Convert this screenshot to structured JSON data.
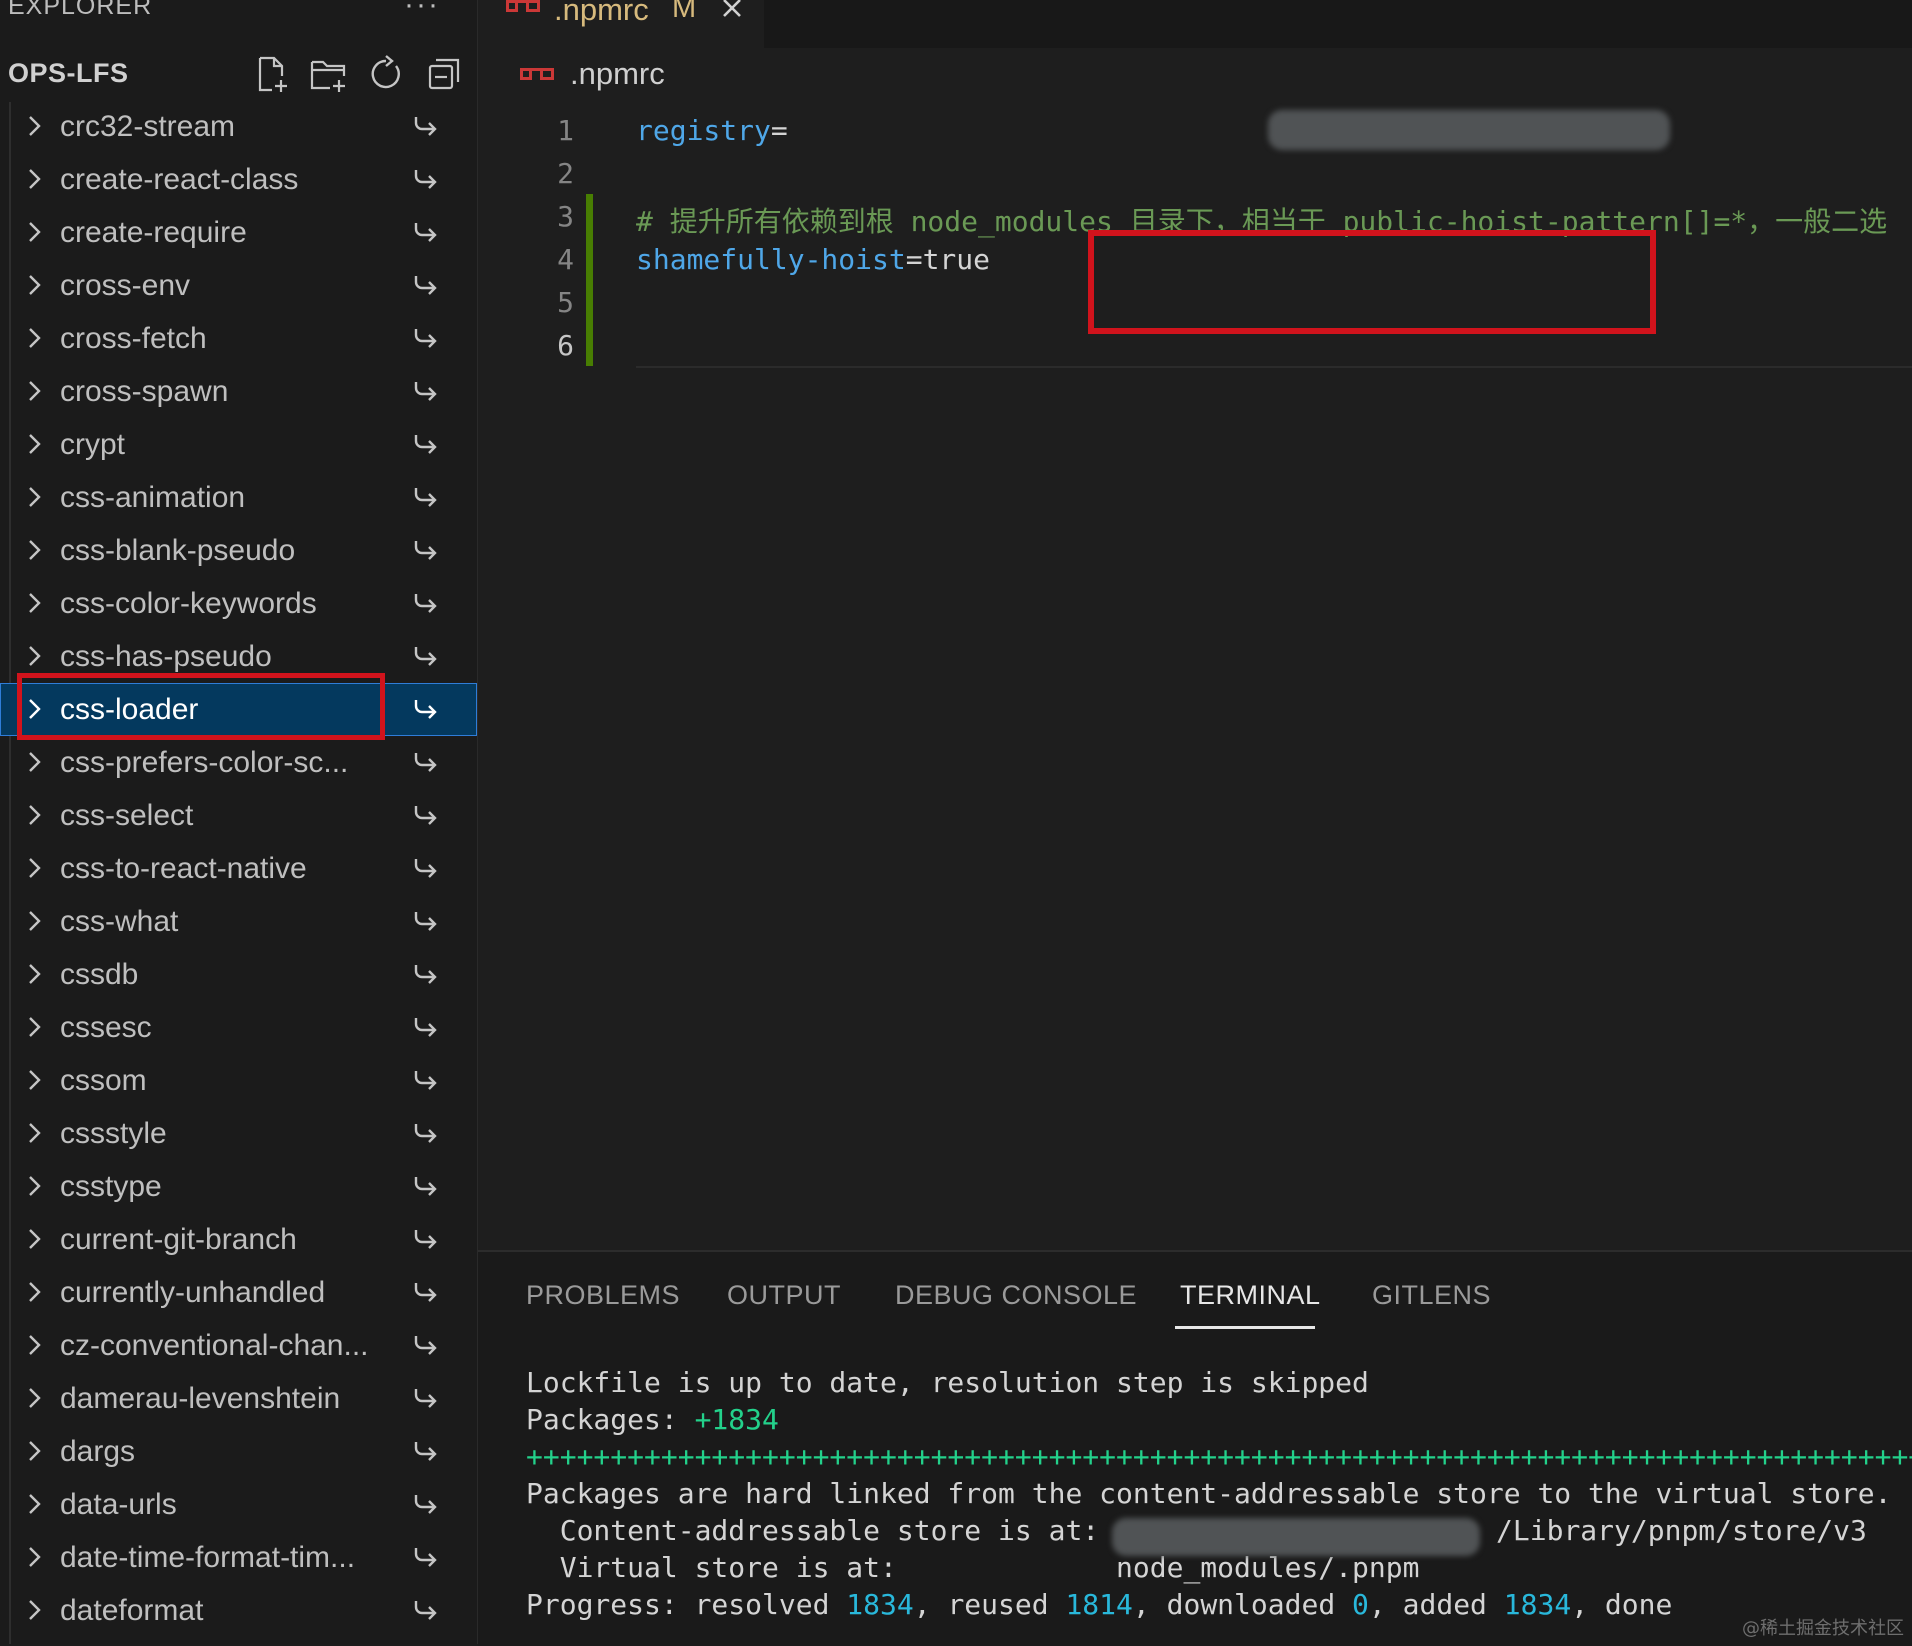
{
  "explorer": {
    "title": "EXPLORER",
    "more": "···",
    "project": "OPS-LFS",
    "actions": [
      "new-file-icon",
      "new-folder-icon",
      "refresh-icon",
      "collapse-all-icon"
    ]
  },
  "tree": {
    "items": [
      "crc32-stream",
      "create-react-class",
      "create-require",
      "cross-env",
      "cross-fetch",
      "cross-spawn",
      "crypt",
      "css-animation",
      "css-blank-pseudo",
      "css-color-keywords",
      "css-has-pseudo",
      "css-loader",
      "css-prefers-color-sc...",
      "css-select",
      "css-to-react-native",
      "css-what",
      "cssdb",
      "cssesc",
      "cssom",
      "cssstyle",
      "csstype",
      "current-git-branch",
      "currently-unhandled",
      "cz-conventional-chan...",
      "damerau-levenshtein",
      "dargs",
      "data-urls",
      "date-time-format-tim...",
      "dateformat"
    ],
    "selected_index": 11,
    "item_icon": "symlink-icon"
  },
  "editor": {
    "tab": {
      "title": ".npmrc",
      "modified": "M",
      "icon": "npm-icon"
    },
    "breadcrumb": ".npmrc",
    "line_numbers": [
      "1",
      "2",
      "3",
      "4",
      "5",
      "6"
    ],
    "current_line": 6,
    "lines": {
      "l1_key": "registry",
      "l1_eq": "=",
      "l3_comment": "# 提升所有依赖到根 node_modules 目录下，相当于 public-hoist-pattern[]=*，一般二选",
      "l4_key": "shamefully-hoist",
      "l4_eq": "=",
      "l4_val": "true"
    }
  },
  "panel": {
    "tabs": [
      "PROBLEMS",
      "OUTPUT",
      "DEBUG CONSOLE",
      "TERMINAL",
      "GITLENS"
    ],
    "active_tab": "TERMINAL",
    "terminal": {
      "line1": "Lockfile is up to date, resolution step is skipped",
      "line2_label": "Packages: ",
      "line2_count": "+1834",
      "line3_bar": "++++++++++++++++++++++++++++++++++++++++++++++++++++++++++++++++++++++++++++++++++++++++++++++++++++++++++++++++",
      "line4": "Packages are hard linked from the content-addressable store to the virtual store.",
      "line5_label": "  Content-addressable store is at: ",
      "line5_path": "/Library/pnpm/store/v3",
      "line6_label": "  Virtual store is at:             ",
      "line6_path": "node_modules/.pnpm",
      "line7_parts": {
        "p1": "Progress: resolved ",
        "resolved": "1834",
        "p2": ", reused ",
        "reused": "1814",
        "p3": ", downloaded ",
        "downloaded": "0",
        "p4": ", added ",
        "added": "1834",
        "p5": ", done"
      }
    }
  },
  "watermark": "@稀土掘金技术社区",
  "colors": {
    "highlight_box": "#d1131c",
    "selection_bg": "#04395e",
    "terminal_green": "#23d18b",
    "terminal_blue": "#29b8db",
    "code_key": "#4fa7e8",
    "comment": "#6a9955",
    "tab_modified": "#d7ba7d"
  }
}
